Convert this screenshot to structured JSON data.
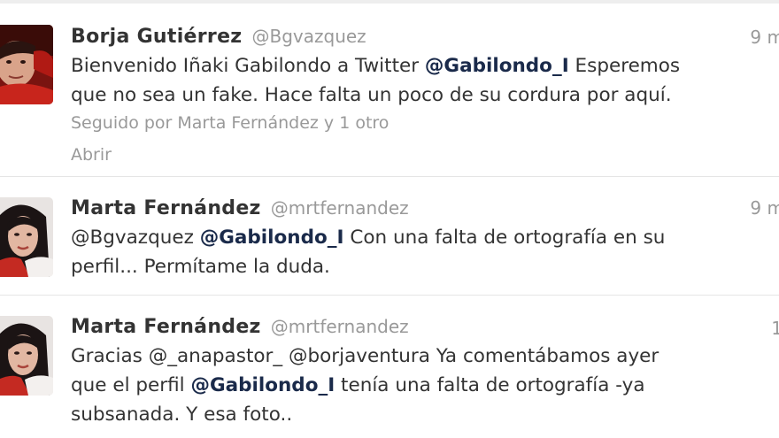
{
  "tweets": [
    {
      "name": "Borja Gutiérrez",
      "screen_name": "@Bgvazquez",
      "time": "9 m",
      "line1_a": "Bienvenido Iñaki Gabilondo a Twitter ",
      "line1_mention": "@Gabilondo_I",
      "line1_b": " Esperemos",
      "line2": "que no sea un fake. Hace falta un poco de su cordura por aquí.",
      "followed_by": "Seguido por Marta Fernández y 1 otro",
      "expand": "Abrir"
    },
    {
      "name": "Marta Fernández",
      "screen_name": "@mrtfernandez",
      "time": "9 m",
      "line1_mention1": "@Bgvazquez",
      "line1_mention2": "@Gabilondo_I",
      "line1_b": " Con una falta de ortografía en su",
      "line2": "perfil... Permítame la duda."
    },
    {
      "name": "Marta Fernández",
      "screen_name": "@mrtfernandez",
      "time": "1",
      "line1_a": "Gracias ",
      "line1_mention1": "@_anapastor_",
      "line1_mention2": "@borjaventura",
      "line1_b": " Ya comentábamos ayer",
      "line2_a": "que el perfil ",
      "line2_mention": "@Gabilondo_I",
      "line2_b": " tenía una falta de ortografía -ya",
      "line3": "subsanada. Y esa foto.."
    }
  ],
  "colors": {
    "text": "#333333",
    "muted": "#999999",
    "mention_bold": "#1a2a4a",
    "divider": "#e5e5e5"
  },
  "icons": {
    "avatar_1": "avatar-borja",
    "avatar_2": "avatar-marta",
    "avatar_3": "avatar-marta"
  }
}
